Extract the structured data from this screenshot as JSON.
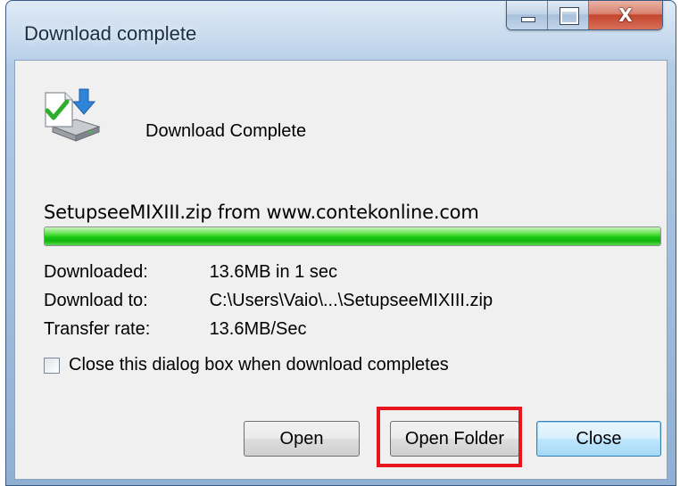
{
  "window": {
    "title": "Download complete",
    "close_glyph": "X"
  },
  "dialog": {
    "heading": "Download Complete",
    "file_source": "SetupseeMIXIII.zip from www.contekonline.com",
    "progress_percent": 100,
    "info": [
      {
        "label": "Downloaded:",
        "value": "13.6MB in 1 sec"
      },
      {
        "label": "Download to:",
        "value": "C:\\Users\\Vaio\\...\\SetupseeMIXIII.zip"
      },
      {
        "label": "Transfer rate:",
        "value": "13.6MB/Sec"
      }
    ],
    "close_on_complete": {
      "label": "Close this dialog box when download completes",
      "checked": false
    }
  },
  "buttons": {
    "open": "Open",
    "open_folder": "Open Folder",
    "close": "Close"
  },
  "colors": {
    "highlight": "#e8141e",
    "progress": "#18c912"
  }
}
